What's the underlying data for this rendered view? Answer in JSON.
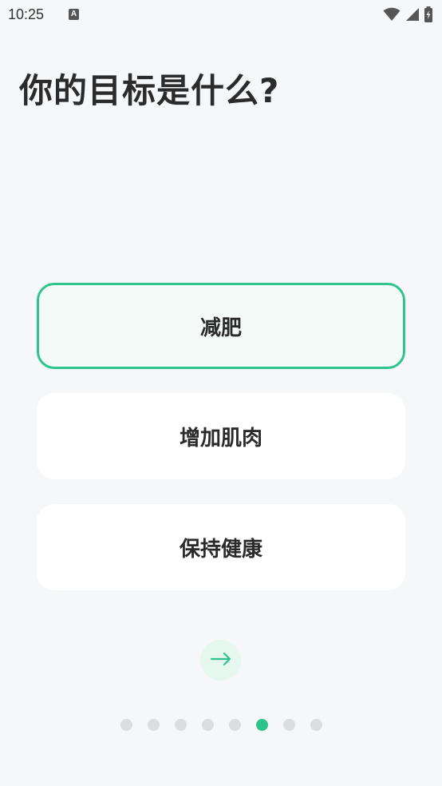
{
  "status_bar": {
    "time": "10:25",
    "notification_icon": "a-icon",
    "wifi_icon": "wifi-icon",
    "signal_icon": "signal-icon",
    "battery_icon": "battery-charging-icon"
  },
  "page": {
    "title": "你的目标是什么?"
  },
  "options": [
    {
      "label": "减肥",
      "selected": true
    },
    {
      "label": "增加肌肉",
      "selected": false
    },
    {
      "label": "保持健康",
      "selected": false
    }
  ],
  "next_button": {
    "icon": "arrow-right-icon"
  },
  "pager": {
    "total": 8,
    "current": 6
  },
  "colors": {
    "accent": "#2fc48d",
    "background": "#f6f7f9",
    "card": "#ffffff",
    "selected_card": "#f3faf7",
    "dot_inactive": "#dcdde0"
  }
}
